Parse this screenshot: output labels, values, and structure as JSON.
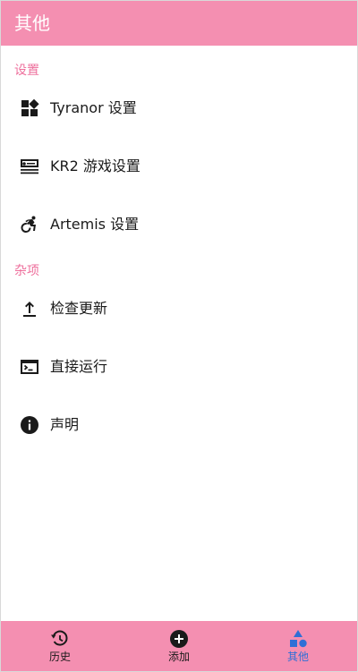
{
  "app_bar": {
    "title": "其他"
  },
  "sections": {
    "settings": {
      "header": "设置",
      "items": [
        {
          "label": "Tyranor 设置",
          "icon": "widgets-icon"
        },
        {
          "label": "KR2 游戏设置",
          "icon": "train-icon"
        },
        {
          "label": "Artemis 设置",
          "icon": "accessible-forward-icon"
        }
      ]
    },
    "misc": {
      "header": "杂项",
      "items": [
        {
          "label": "检查更新",
          "icon": "upload-icon"
        },
        {
          "label": "直接运行",
          "icon": "terminal-icon"
        },
        {
          "label": "声明",
          "icon": "info-icon"
        }
      ]
    }
  },
  "bottom_nav": {
    "items": [
      {
        "label": "历史",
        "icon": "history-icon",
        "active": false
      },
      {
        "label": "添加",
        "icon": "add-circle-icon",
        "active": false
      },
      {
        "label": "其他",
        "icon": "category-icon",
        "active": true
      }
    ],
    "active_color": "#2f6fd6"
  },
  "colors": {
    "primary": "#f48fb1",
    "section_header": "#ee6f9c"
  }
}
